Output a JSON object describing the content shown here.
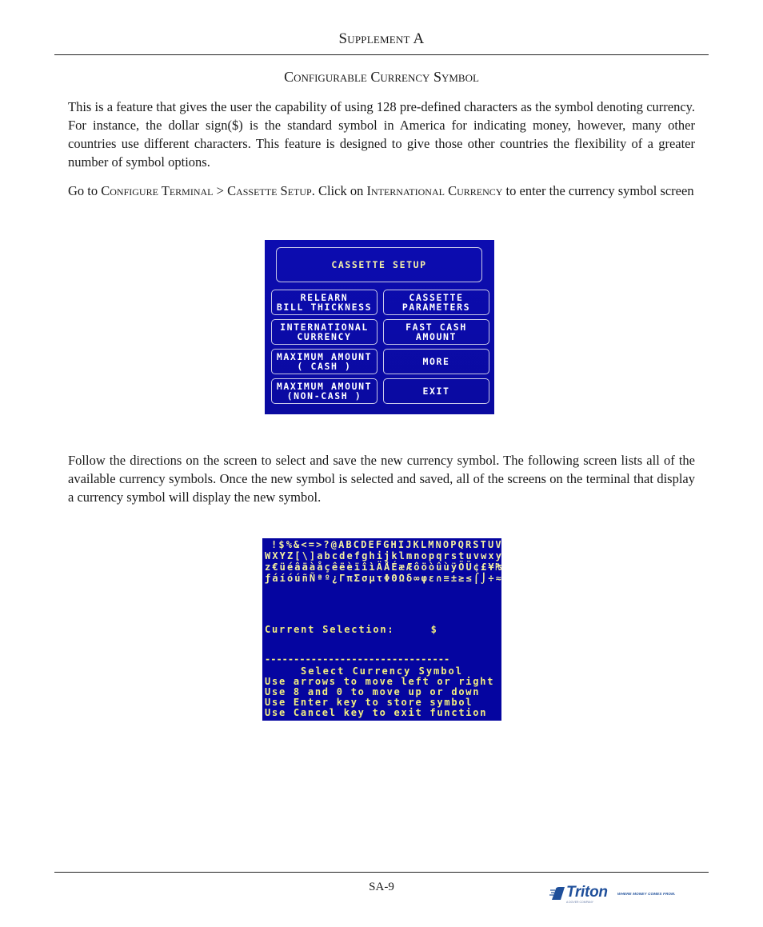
{
  "header": {
    "title": "Supplement A"
  },
  "section": {
    "title": "Configurable Currency Symbol"
  },
  "paragraphs": {
    "intro": "This is a feature that gives the user the capability of using 128 pre-defined characters as the symbol denoting currency.  For instance, the dollar sign($) is the standard symbol in America for indicating money, however, many other countries use different characters.  This feature is designed to give those other countries the flexibility of a greater number of symbol options.",
    "nav": {
      "prefix": "Go to ",
      "menu1": "Configure Terminal",
      "sep": " > ",
      "menu2": "Cassette Setup",
      "mid": ".  Click on ",
      "menu3": "International Currency",
      "suffix": " to enter the currency symbol screen"
    },
    "follow": "Follow the directions on the screen to select and save the new currency symbol.  The following screen lists all of the available currency symbols.  Once the new symbol is selected and saved, all of the screens on the terminal that display a currency symbol will display the new symbol."
  },
  "cassette_screen": {
    "title": "CASSETTE SETUP",
    "buttons": {
      "relearn": "RELEARN\nBILL THICKNESS",
      "cassette_params": "CASSETTE\nPARAMETERS",
      "intl_currency": "INTERNATIONAL\nCURRENCY",
      "fast_cash": "FAST CASH\nAMOUNT",
      "max_cash": "MAXIMUM AMOUNT\n( CASH )",
      "more": "MORE",
      "max_noncash": "MAXIMUM AMOUNT\n(NON-CASH )",
      "exit": "EXIT"
    }
  },
  "currency_screen": {
    "symbol_rows": [
      [
        "!",
        "$",
        "%",
        "&",
        "<",
        "=",
        ">",
        "?",
        "@",
        "A",
        "B",
        "C",
        "D",
        "E",
        "F",
        "G",
        "H",
        "I",
        "J",
        "K",
        "L",
        "M",
        "N",
        "O",
        "P",
        "Q",
        "R",
        "S",
        "T",
        "U",
        "V"
      ],
      [
        "W",
        "X",
        "Y",
        "Z",
        "[",
        "\\",
        "]",
        "a",
        "b",
        "c",
        "d",
        "e",
        "f",
        "g",
        "h",
        "i",
        "j",
        "k",
        "l",
        "m",
        "n",
        "o",
        "p",
        "q",
        "r",
        "s",
        "t",
        "u",
        "v",
        "w",
        "x",
        "y"
      ],
      [
        "z",
        "€",
        "ü",
        "é",
        "â",
        "ä",
        "à",
        "å",
        "ç",
        "ê",
        "ë",
        "è",
        "ï",
        "î",
        "ì",
        "Ä",
        "Å",
        "É",
        "æ",
        "Æ",
        "ô",
        "ö",
        "ò",
        "û",
        "ù",
        "ÿ",
        "Ö",
        "Ü",
        "¢",
        "£",
        "¥",
        "₧"
      ],
      [
        "ƒ",
        "á",
        "í",
        "ó",
        "ú",
        "ñ",
        "Ñ",
        "ª",
        "º",
        "¿",
        "Γ",
        "π",
        "Σ",
        "σ",
        "µ",
        "τ",
        "Φ",
        "Θ",
        "Ω",
        "δ",
        "∞",
        "φ",
        "ε",
        "∩",
        "≡",
        "±",
        "≥",
        "≤",
        "⌠",
        "⌡",
        "÷",
        "≈"
      ]
    ],
    "current_selection_label": "Current Selection:",
    "current_selection_value": "$",
    "divider": "--------------------------------",
    "instructions_title": "Select Currency Symbol",
    "instructions": [
      "Use arrows to move left or right",
      "Use 8 and 0 to move up or down",
      "Use Enter key to store symbol",
      "Use Cancel key to exit function"
    ]
  },
  "footer": {
    "page_number": "SA-9",
    "logo_name": "Triton",
    "logo_tagline": "WHERE MONEY COMES FROM.",
    "logo_subline": "A DOVER COMPANY"
  }
}
